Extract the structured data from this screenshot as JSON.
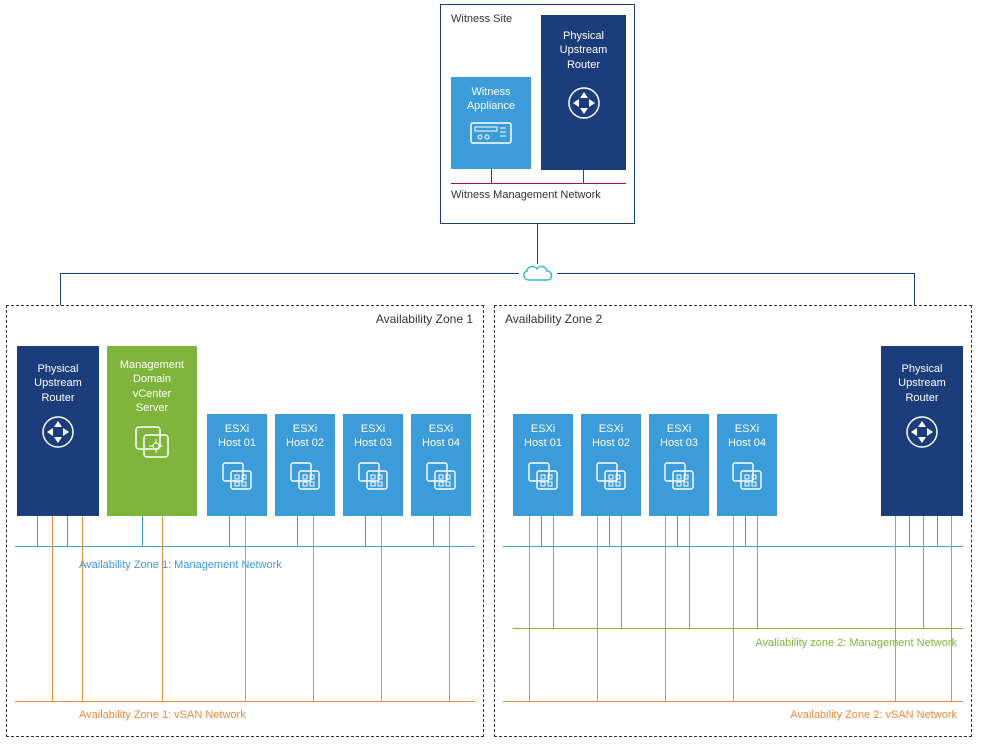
{
  "witness": {
    "site_label": "Witness\nSite",
    "appliance_label": "Witness\nAppliance",
    "router_label": "Physical\nUpstream\nRouter",
    "network_label": "Witness\nManagement\nNetwork"
  },
  "zone1": {
    "title": "Availability Zone 1",
    "router_label": "Physical\nUpstream\nRouter",
    "vcenter_label": "Management\nDomain\nvCenter\nServer",
    "hosts": [
      "ESXi\nHost 01",
      "ESXi\nHost 02",
      "ESXi\nHost 03",
      "ESXi\nHost 04"
    ],
    "mgmt_net_label": "Availability Zone 1:\nManagement\nNetwork",
    "vsan_net_label": "Availability Zone 1:\nvSAN Network"
  },
  "zone2": {
    "title": "Availability Zone 2",
    "router_label": "Physical\nUpstream\nRouter",
    "hosts": [
      "ESXi\nHost 01",
      "ESXi\nHost 02",
      "ESXi\nHost 03",
      "ESXi\nHost 04"
    ],
    "mgmt_net_label": "Avaliability zone 2:\nManagement\nNetwork",
    "vsan_net_label": "Availability Zone 2:\nvSAN Network"
  },
  "colors": {
    "dark_blue": "#1b3d7c",
    "light_blue": "#3b9cd9",
    "green": "#7fb53d",
    "orange": "#e88b3a",
    "maroon": "#b01030"
  },
  "chart_data": {
    "type": "diagram",
    "description": "Network topology showing a Witness Site connected via WAN cloud to two Availability Zones. Each zone has a physical upstream router and four ESXi hosts on management and vSAN networks. Zone 1 additionally hosts the Management Domain vCenter Server. Zone 2 hosts also drop to a second (green) management network.",
    "nodes": [
      {
        "id": "witness-site",
        "label": "Witness Site",
        "contains": [
          "witness-appliance",
          "witness-router"
        ]
      },
      {
        "id": "witness-appliance",
        "label": "Witness Appliance",
        "type": "appliance"
      },
      {
        "id": "witness-router",
        "label": "Physical Upstream Router",
        "type": "router"
      },
      {
        "id": "cloud",
        "label": "WAN",
        "type": "cloud"
      },
      {
        "id": "az1",
        "label": "Availability Zone 1",
        "contains": [
          "az1-router",
          "az1-vcenter",
          "az1-h1",
          "az1-h2",
          "az1-h3",
          "az1-h4"
        ]
      },
      {
        "id": "az1-router",
        "label": "Physical Upstream Router",
        "type": "router"
      },
      {
        "id": "az1-vcenter",
        "label": "Management Domain vCenter Server",
        "type": "vcenter"
      },
      {
        "id": "az1-h1",
        "label": "ESXi Host 01",
        "type": "host"
      },
      {
        "id": "az1-h2",
        "label": "ESXi Host 02",
        "type": "host"
      },
      {
        "id": "az1-h3",
        "label": "ESXi Host 03",
        "type": "host"
      },
      {
        "id": "az1-h4",
        "label": "ESXi Host 04",
        "type": "host"
      },
      {
        "id": "az2",
        "label": "Availability Zone 2",
        "contains": [
          "az2-router",
          "az2-h1",
          "az2-h2",
          "az2-h3",
          "az2-h4"
        ]
      },
      {
        "id": "az2-router",
        "label": "Physical Upstream Router",
        "type": "router"
      },
      {
        "id": "az2-h1",
        "label": "ESXi Host 01",
        "type": "host"
      },
      {
        "id": "az2-h2",
        "label": "ESXi Host 02",
        "type": "host"
      },
      {
        "id": "az2-h3",
        "label": "ESXi Host 03",
        "type": "host"
      },
      {
        "id": "az2-h4",
        "label": "ESXi Host 04",
        "type": "host"
      }
    ],
    "networks": [
      {
        "id": "witness-mgmt",
        "label": "Witness Management Network",
        "color": "#b01030",
        "members": [
          "witness-appliance",
          "witness-router"
        ]
      },
      {
        "id": "az1-mgmt",
        "label": "Availability Zone 1: Management Network",
        "color": "#3b9cd9",
        "members": [
          "az1-router",
          "az1-vcenter",
          "az1-h1",
          "az1-h2",
          "az1-h3",
          "az1-h4"
        ],
        "extends_to": "az2"
      },
      {
        "id": "az1-vsan",
        "label": "Availability Zone 1: vSAN Network",
        "color": "#e88b3a",
        "members": [
          "az1-router",
          "az1-vcenter",
          "az1-h1",
          "az1-h2",
          "az1-h3",
          "az1-h4"
        ]
      },
      {
        "id": "az2-mgmt",
        "label": "Avaliability zone 2: Management Network",
        "color": "#7fb53d",
        "members": [
          "az2-h1",
          "az2-h2",
          "az2-h3",
          "az2-h4",
          "az2-router"
        ]
      },
      {
        "id": "az2-vsan",
        "label": "Availability Zone 2: vSAN Network",
        "color": "#e88b3a",
        "members": [
          "az2-router",
          "az2-h1",
          "az2-h2",
          "az2-h3",
          "az2-h4"
        ]
      }
    ],
    "links": [
      {
        "from": "witness-router",
        "to": "cloud"
      },
      {
        "from": "cloud",
        "to": "az1-router"
      },
      {
        "from": "cloud",
        "to": "az2-router"
      }
    ]
  }
}
